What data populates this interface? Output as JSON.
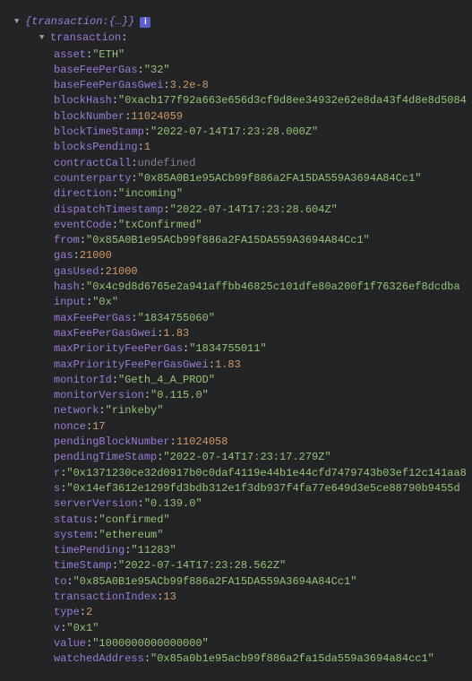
{
  "root_label": "transaction",
  "root_preview": "{…}",
  "info_glyph": "i",
  "fields": [
    {
      "key": "asset",
      "value": "\"ETH\"",
      "type": "string"
    },
    {
      "key": "baseFeePerGas",
      "value": "\"32\"",
      "type": "string"
    },
    {
      "key": "baseFeePerGasGwei",
      "value": "3.2e-8",
      "type": "number"
    },
    {
      "key": "blockHash",
      "value": "\"0xacb177f92a663e656d3cf9d8ee34932e62e8da43f4d8e8d5084",
      "type": "string"
    },
    {
      "key": "blockNumber",
      "value": "11024059",
      "type": "number"
    },
    {
      "key": "blockTimeStamp",
      "value": "\"2022-07-14T17:23:28.000Z\"",
      "type": "string"
    },
    {
      "key": "blocksPending",
      "value": "1",
      "type": "number"
    },
    {
      "key": "contractCall",
      "value": "undefined",
      "type": "undef"
    },
    {
      "key": "counterparty",
      "value": "\"0x85A0B1e95ACb99f886a2FA15DA559A3694A84Cc1\"",
      "type": "string"
    },
    {
      "key": "direction",
      "value": "\"incoming\"",
      "type": "string"
    },
    {
      "key": "dispatchTimestamp",
      "value": "\"2022-07-14T17:23:28.604Z\"",
      "type": "string"
    },
    {
      "key": "eventCode",
      "value": "\"txConfirmed\"",
      "type": "string"
    },
    {
      "key": "from",
      "value": "\"0x85A0B1e95ACb99f886a2FA15DA559A3694A84Cc1\"",
      "type": "string"
    },
    {
      "key": "gas",
      "value": "21000",
      "type": "number"
    },
    {
      "key": "gasUsed",
      "value": "21000",
      "type": "number"
    },
    {
      "key": "hash",
      "value": "\"0x4c9d8d6765e2a941affbb46825c101dfe80a200f1f76326ef8dcdba",
      "type": "string"
    },
    {
      "key": "input",
      "value": "\"0x\"",
      "type": "string"
    },
    {
      "key": "maxFeePerGas",
      "value": "\"1834755060\"",
      "type": "string"
    },
    {
      "key": "maxFeePerGasGwei",
      "value": "1.83",
      "type": "number"
    },
    {
      "key": "maxPriorityFeePerGas",
      "value": "\"1834755011\"",
      "type": "string"
    },
    {
      "key": "maxPriorityFeePerGasGwei",
      "value": "1.83",
      "type": "number"
    },
    {
      "key": "monitorId",
      "value": "\"Geth_4_A_PROD\"",
      "type": "string"
    },
    {
      "key": "monitorVersion",
      "value": "\"0.115.0\"",
      "type": "string"
    },
    {
      "key": "network",
      "value": "\"rinkeby\"",
      "type": "string"
    },
    {
      "key": "nonce",
      "value": "17",
      "type": "number"
    },
    {
      "key": "pendingBlockNumber",
      "value": "11024058",
      "type": "number"
    },
    {
      "key": "pendingTimeStamp",
      "value": "\"2022-07-14T17:23:17.279Z\"",
      "type": "string"
    },
    {
      "key": "r",
      "value": "\"0x1371230ce32d0917b0c0daf4119e44b1e44cfd7479743b03ef12c141aa8",
      "type": "string"
    },
    {
      "key": "s",
      "value": "\"0x14ef3612e1299fd3bdb312e1f3db937f4fa77e649d3e5ce88790b9455d",
      "type": "string"
    },
    {
      "key": "serverVersion",
      "value": "\"0.139.0\"",
      "type": "string"
    },
    {
      "key": "status",
      "value": "\"confirmed\"",
      "type": "string"
    },
    {
      "key": "system",
      "value": "\"ethereum\"",
      "type": "string"
    },
    {
      "key": "timePending",
      "value": "\"11283\"",
      "type": "string"
    },
    {
      "key": "timeStamp",
      "value": "\"2022-07-14T17:23:28.562Z\"",
      "type": "string"
    },
    {
      "key": "to",
      "value": "\"0x85A0B1e95ACb99f886a2FA15DA559A3694A84Cc1\"",
      "type": "string"
    },
    {
      "key": "transactionIndex",
      "value": "13",
      "type": "number"
    },
    {
      "key": "type",
      "value": "2",
      "type": "number"
    },
    {
      "key": "v",
      "value": "\"0x1\"",
      "type": "string"
    },
    {
      "key": "value",
      "value": "\"1000000000000000\"",
      "type": "string"
    },
    {
      "key": "watchedAddress",
      "value": "\"0x85a0b1e95acb99f886a2fa15da559a3694a84cc1\"",
      "type": "string"
    }
  ]
}
